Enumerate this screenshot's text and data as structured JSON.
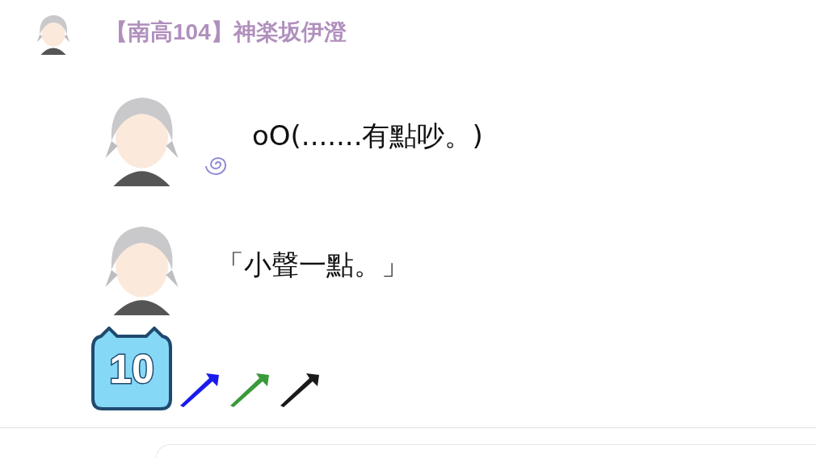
{
  "post": {
    "author": "【南高104】神楽坂伊澄"
  },
  "messages": [
    {
      "kind": "thought",
      "text": "oO(.......有點吵。)"
    },
    {
      "kind": "speech",
      "text": "「小聲一點。」"
    }
  ],
  "badge": {
    "text": "10"
  },
  "horns": [
    {
      "color": "#1a1aee"
    },
    {
      "color": "#3a9a3a"
    },
    {
      "color": "#1a1a1a"
    }
  ]
}
